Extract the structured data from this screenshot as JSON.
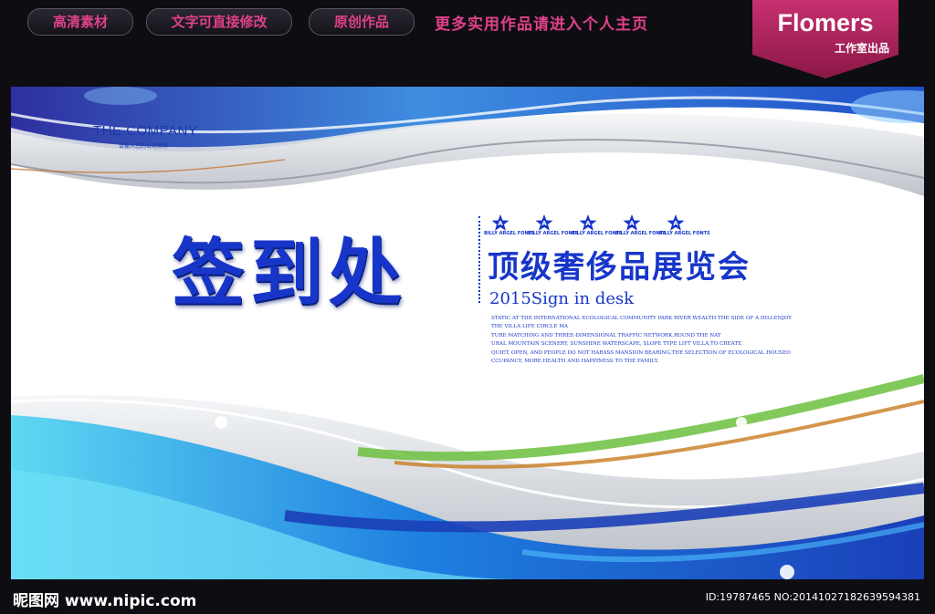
{
  "top_bar": {
    "pills": [
      "高清素材",
      "文字可直接修改",
      "原创作品"
    ],
    "message": "更多实用作品请进入个人主页"
  },
  "badge": {
    "brand": "Flomers",
    "sub": "工作室出品"
  },
  "poster": {
    "company": "THE COMPANY",
    "company_sub": "请输入您的公司名称",
    "main_title": "签到处",
    "stars": [
      "A",
      "A",
      "A",
      "A",
      "A"
    ],
    "star_caption": "BILLY ARGEL FONTS",
    "sub_title": "顶级奢侈品展览会",
    "year_line": "2015Sign in desk",
    "body_lines": [
      "STATIC AT THE INTERNATIONAL ECOLOGICAL COMMUNITY PARK RIVER WEALTH THE SIDE OF A HILLENJOY",
      "THE VILLA LIFE CIRCLE MA",
      "TURE MATCHING AND THREE-DIMENSIONAL TRAFFIC NETWORK,ROUND THE NAT",
      "URAL MOUNTAIN SCENERY, SUNSHINE WATERSCAPE, SLOPE TYPE LIFT VILLA,TO CREATE",
      "QUIET, OPEN, AND PEOPLE DO NOT HARASS MANSION BEARING,THE SELECTION OF ECOLOGICAL HOUSEO",
      "CCUPANCY, MORE HEALTH AND HAPPINESS TO THE FAMILY."
    ]
  },
  "footer": {
    "site": "昵图网 www.nipic.com",
    "id_text": "ID:19787465 NO:20141027182639594381"
  },
  "colors": {
    "accent_pink": "#e0418a",
    "title_blue": "#1736c9",
    "badge_bg": "#b0255f"
  }
}
